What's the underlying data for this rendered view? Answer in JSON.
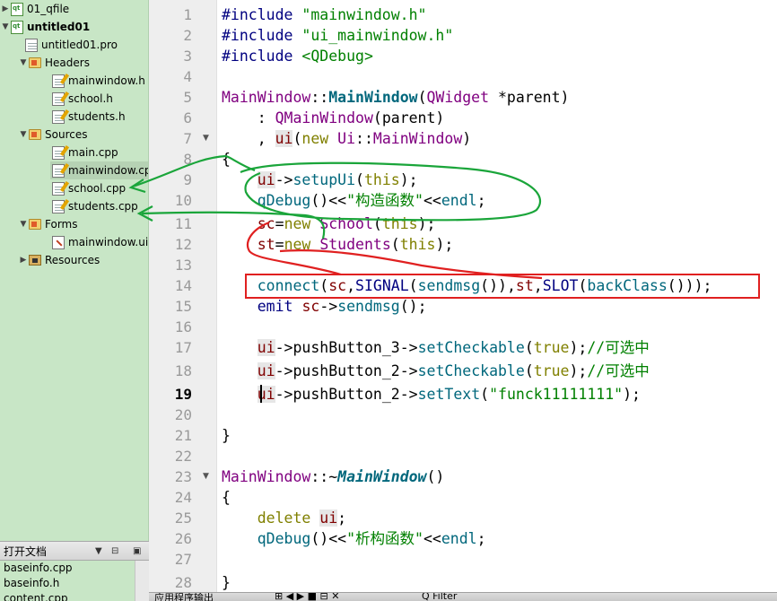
{
  "tree": {
    "items": [
      {
        "label": "01_qfile",
        "icon": "qt-project-icon",
        "arrow": "▶"
      },
      {
        "label": "untitled01",
        "icon": "qt-project-icon",
        "arrow": "▼"
      },
      {
        "label": "untitled01.pro",
        "icon": "pro-file-icon",
        "arrow": ""
      },
      {
        "label": "Headers",
        "icon": "headers-folder-icon",
        "arrow": "▼"
      },
      {
        "label": "mainwindow.h",
        "icon": "header-file-icon",
        "arrow": ""
      },
      {
        "label": "school.h",
        "icon": "header-file-icon",
        "arrow": ""
      },
      {
        "label": "students.h",
        "icon": "header-file-icon",
        "arrow": ""
      },
      {
        "label": "Sources",
        "icon": "sources-folder-icon",
        "arrow": "▼"
      },
      {
        "label": "main.cpp",
        "icon": "cpp-file-icon",
        "arrow": ""
      },
      {
        "label": "mainwindow.cpp",
        "icon": "cpp-file-icon",
        "arrow": ""
      },
      {
        "label": "school.cpp",
        "icon": "cpp-file-icon",
        "arrow": ""
      },
      {
        "label": "students.cpp",
        "icon": "cpp-file-icon",
        "arrow": ""
      },
      {
        "label": "Forms",
        "icon": "forms-folder-icon",
        "arrow": "▼"
      },
      {
        "label": "mainwindow.ui",
        "icon": "ui-file-icon",
        "arrow": ""
      },
      {
        "label": "Resources",
        "icon": "resources-icon",
        "arrow": "▶"
      }
    ]
  },
  "open_docs": {
    "title": "打开文档",
    "split_label": "⊟",
    "close_label": "▣",
    "menu_arrow": "▼",
    "items": [
      "baseinfo.cpp",
      "baseinfo.h",
      "content.cpp"
    ]
  },
  "bottom": {
    "label": "应用程序输出",
    "controls": "⊞  ◀  ▶  ■  ⊟  ✕",
    "search_placeholder": "Q Filter"
  },
  "editor": {
    "current_line": 19,
    "line_numbers": [
      "1",
      "2",
      "3",
      "4",
      "5",
      "6",
      "7",
      "8",
      "9",
      "10",
      "11",
      "12",
      "13",
      "14",
      "15",
      "16",
      "17",
      "18",
      "19",
      "20",
      "21",
      "22",
      "23",
      "24",
      "25",
      "26",
      "27",
      "28"
    ],
    "fold_markers": [
      {
        "line": 7,
        "mark": "▼"
      },
      {
        "line": 23,
        "mark": "▼"
      }
    ]
  },
  "code": {
    "l1": [
      "#include ",
      "\"mainwindow.h\""
    ],
    "l2": [
      "#include ",
      "\"ui_mainwindow.h\""
    ],
    "l3": [
      "#include ",
      "<QDebug>"
    ],
    "l5": [
      "MainWindow",
      "::",
      "MainWindow",
      "(",
      "QWidget",
      " *parent)"
    ],
    "l6": [
      "    : ",
      "QMainWindow",
      "(parent)"
    ],
    "l7": [
      "    , ",
      "ui",
      "(",
      "new",
      " ",
      "Ui",
      "::",
      "MainWindow",
      ")"
    ],
    "l8": [
      "{"
    ],
    "l9": [
      "    ",
      "ui",
      "->",
      "setupUi",
      "(",
      "this",
      ");"
    ],
    "l10": [
      "    ",
      "qDebug",
      "()<<",
      "\"构造函数\"",
      "<<",
      "endl",
      ";"
    ],
    "l11": [
      "    ",
      "sc",
      "=",
      "new",
      " ",
      "School",
      "(",
      "this",
      ");"
    ],
    "l12": [
      "    ",
      "st",
      "=",
      "new",
      " ",
      "Students",
      "(",
      "this",
      ");"
    ],
    "l14": [
      "    ",
      "connect",
      "(",
      "sc",
      ",",
      "SIGNAL",
      "(",
      "sendmsg",
      "()),",
      "st",
      ",",
      "SLOT",
      "(",
      "backClass",
      "()));"
    ],
    "l15": [
      "    ",
      "emit",
      " ",
      "sc",
      "->",
      "sendmsg",
      "();"
    ],
    "l17": [
      "    ",
      "ui",
      "->",
      "pushButton_3",
      "->",
      "setCheckable",
      "(",
      "true",
      ");",
      "//可选中"
    ],
    "l18": [
      "    ",
      "ui",
      "->",
      "pushButton_2",
      "->",
      "setCheckable",
      "(",
      "true",
      ");",
      "//可选中"
    ],
    "l19": [
      "    ",
      "ui",
      "->",
      "pushButton_2",
      "->",
      "setText",
      "(",
      "\"funck11111111\"",
      ");"
    ],
    "l21": [
      "}"
    ],
    "l23": [
      "MainWindow",
      "::~",
      "MainWindow",
      "()"
    ],
    "l24": [
      "{"
    ],
    "l25": [
      "    ",
      "delete",
      " ",
      "ui",
      ";"
    ],
    "l26": [
      "    ",
      "qDebug",
      "()<<",
      "\"析构函数\"",
      "<<",
      "endl",
      ";"
    ],
    "l28": [
      "}"
    ]
  },
  "colors": {
    "tree_bg": "#c8e6c6",
    "annotation_green": "#1aa53a",
    "annotation_red": "#e02020"
  }
}
